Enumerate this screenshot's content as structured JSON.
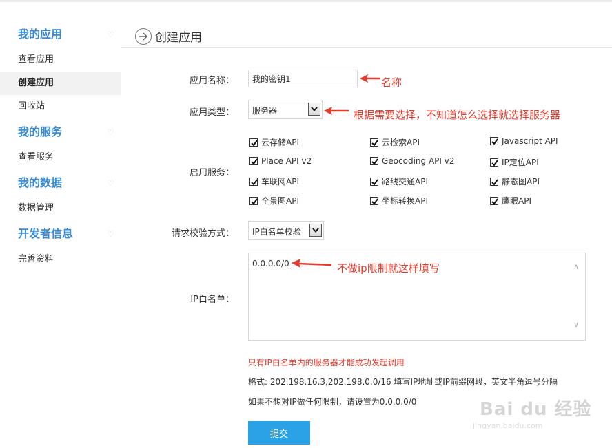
{
  "sidebar": {
    "groups": [
      {
        "title": "我的应用",
        "items": [
          "查看应用",
          "创建应用",
          "回收站"
        ]
      },
      {
        "title": "我的服务",
        "items": [
          "查看服务"
        ]
      },
      {
        "title": "我的数据",
        "items": [
          "数据管理"
        ]
      },
      {
        "title": "开发者信息",
        "items": [
          "完善资料"
        ]
      }
    ],
    "active_item": "创建应用"
  },
  "header": {
    "title": "创建应用"
  },
  "form": {
    "name_label": "应用名称：",
    "name_value": "我的密钥1",
    "type_label": "应用类型：",
    "type_value": "服务器",
    "services_label": "启用服务：",
    "services": [
      {
        "label": "云存储API",
        "checked": true
      },
      {
        "label": "云检索API",
        "checked": true
      },
      {
        "label": "Javascript API",
        "checked": true
      },
      {
        "label": "Place API v2",
        "checked": true
      },
      {
        "label": "Geocoding API v2",
        "checked": true
      },
      {
        "label": "IP定位API",
        "checked": true
      },
      {
        "label": "车联网API",
        "checked": true
      },
      {
        "label": "路线交通API",
        "checked": true
      },
      {
        "label": "静态图API",
        "checked": true
      },
      {
        "label": "全景图API",
        "checked": true
      },
      {
        "label": "坐标转换API",
        "checked": true
      },
      {
        "label": "鹰眼API",
        "checked": true
      }
    ],
    "check_label": "请求校验方式：",
    "check_value": "IP白名单校验",
    "ip_label": "IP白名单：",
    "ip_value": "0.0.0.0/0",
    "warning": "只有IP白名单内的服务器才能成功发起调用",
    "format_hint": "格式: 202.198.16.3,202.198.0.0/16 填写IP地址或IP前缀网段，英文半角逗号分隔",
    "no_limit_hint": "如果不想对IP做任何限制，请设置为0.0.0.0/0",
    "submit_label": "提交"
  },
  "annotations": {
    "name": "名称",
    "type": "根据需要选择，不知道怎么选择就选择服务器",
    "ip": "不做ip限制就这样填写"
  },
  "watermark": {
    "text": "Bai du 经验",
    "url": "jingyan.baidu.com"
  },
  "colors": {
    "accent": "#3a8bd6",
    "button": "#2ba2e5",
    "annotation": "#e53b2c"
  }
}
